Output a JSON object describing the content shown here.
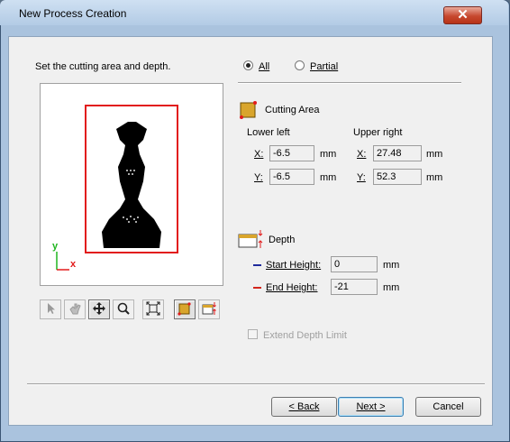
{
  "window": {
    "title": "New Process Creation",
    "close_glyph": "✕"
  },
  "instruction": "Set the cutting area and depth.",
  "mode": {
    "all_label": "All",
    "partial_label": "Partial",
    "selected": "All"
  },
  "cutting_area": {
    "title": "Cutting Area",
    "lower_left": {
      "label": "Lower left",
      "x_label": "X:",
      "x": "-6.5",
      "y_label": "Y:",
      "y": "-6.5"
    },
    "upper_right": {
      "label": "Upper right",
      "x_label": "X:",
      "x": "27.48",
      "y_label": "Y:",
      "y": "52.3"
    },
    "unit": "mm"
  },
  "depth": {
    "title": "Depth",
    "start_label": "Start Height:",
    "start_value": "0",
    "end_label": "End Height:",
    "end_value": "-21",
    "unit": "mm",
    "start_color": "#1f2a9c",
    "end_color": "#d2261d"
  },
  "extend_limit": {
    "label": "Extend Depth Limit",
    "checked": false,
    "enabled": false
  },
  "axes": {
    "x": "x",
    "y": "y",
    "x_color": "#e21b1b",
    "y_color": "#1fb51f"
  },
  "toolbar": [
    "select-icon",
    "pan-hand-icon",
    "move-icon",
    "zoom-icon",
    "fit-icon",
    "cutting-area-icon",
    "depth-icon"
  ],
  "buttons": {
    "back": "< Back",
    "next": "Next >",
    "cancel": "Cancel"
  },
  "colors": {
    "area_frame": "#e21b1b",
    "title_bg": "#b3cbe5",
    "dialog_bg": "#f0f0f0"
  }
}
